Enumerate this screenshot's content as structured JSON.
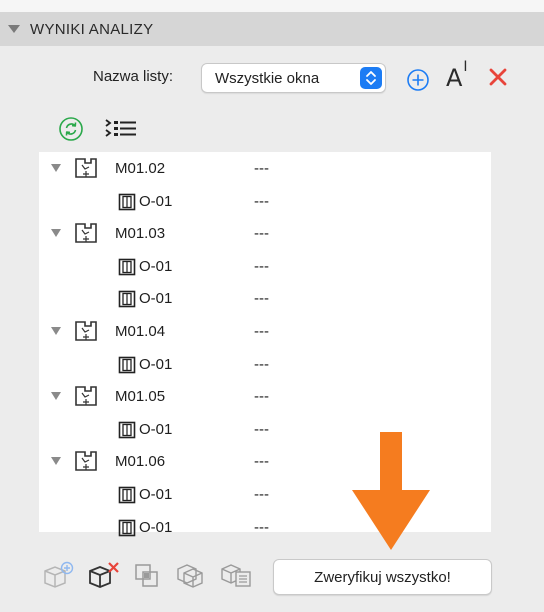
{
  "section": {
    "title": "WYNIKI ANALIZY"
  },
  "list_selector": {
    "label": "Nazwa listy:",
    "selected": "Wszystkie okna",
    "icons": [
      "add-list-icon",
      "rename-icon",
      "delete-icon"
    ],
    "rename_glyph": "A",
    "rename_sup": "I"
  },
  "tree": {
    "rows": [
      {
        "kind": "zone",
        "name": "M01.02",
        "value": "---"
      },
      {
        "kind": "elem",
        "name": "O-01",
        "value": "---"
      },
      {
        "kind": "zone",
        "name": "M01.03",
        "value": "---"
      },
      {
        "kind": "elem",
        "name": "O-01",
        "value": "---"
      },
      {
        "kind": "elem",
        "name": "O-01",
        "value": "---"
      },
      {
        "kind": "zone",
        "name": "M01.04",
        "value": "---"
      },
      {
        "kind": "elem",
        "name": "O-01",
        "value": "---"
      },
      {
        "kind": "zone",
        "name": "M01.05",
        "value": "---"
      },
      {
        "kind": "elem",
        "name": "O-01",
        "value": "---"
      },
      {
        "kind": "zone",
        "name": "M01.06",
        "value": "---"
      },
      {
        "kind": "elem",
        "name": "O-01",
        "value": "---"
      },
      {
        "kind": "elem",
        "name": "O-01",
        "value": "---"
      }
    ]
  },
  "bottom": {
    "verify_label": "Zweryfikuj wszystko!"
  },
  "colors": {
    "accent_blue": "#1c7cf4",
    "delete_red": "#e8443a",
    "refresh_green": "#2aa84a",
    "annotation_orange": "#f57c1f"
  }
}
